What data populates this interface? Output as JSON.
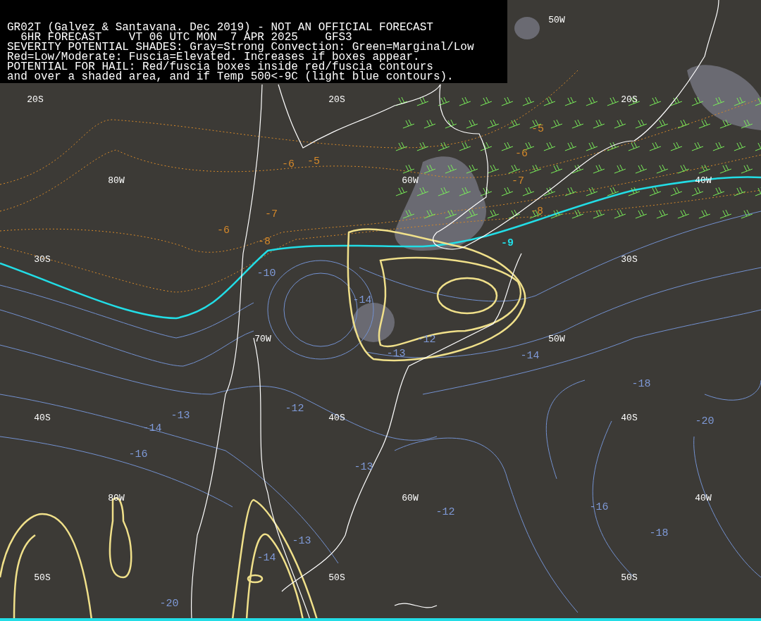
{
  "header": {
    "lines": [
      "GR02T (Galvez & Santavana. Dec 2019) - NOT AN OFFICIAL FORECAST",
      "  6HR FORECAST    VT 06 UTC MON  7 APR 2025    GFS3",
      "SEVERITY POTENTIAL SHADES: Gray=Strong Convection: Green=Marginal/Low",
      "Red=Low/Moderate: Fuscia=Elevated. Increases if boxes appear.",
      "POTENTIAL FOR HAIL: Red/fuscia boxes inside red/fuscia contours",
      "and over a shaded area, and if Temp 500<-9C (light blue contours)."
    ]
  },
  "grid_labels": [
    "50W",
    "20S",
    "20S",
    "20S",
    "80W",
    "60W",
    "40W",
    "30S",
    "30S",
    "70W",
    "50W",
    "40S",
    "40S",
    "40S",
    "80W",
    "60W",
    "40W",
    "50S",
    "50S",
    "50S"
  ],
  "contour_labels": [
    {
      "text": "-5",
      "kind": "height"
    },
    {
      "text": "-6",
      "kind": "height"
    },
    {
      "text": "-6",
      "kind": "height"
    },
    {
      "text": "-5",
      "kind": "height"
    },
    {
      "text": "-7",
      "kind": "height"
    },
    {
      "text": "-6",
      "kind": "height"
    },
    {
      "text": "-7",
      "kind": "height"
    },
    {
      "text": "-8",
      "kind": "height"
    },
    {
      "text": "-8",
      "kind": "height"
    },
    {
      "text": "-9",
      "kind": "threshold"
    },
    {
      "text": "-10",
      "kind": "temperature"
    },
    {
      "text": "-14",
      "kind": "temperature"
    },
    {
      "text": "-12",
      "kind": "temperature"
    },
    {
      "text": "-13",
      "kind": "temperature"
    },
    {
      "text": "-14",
      "kind": "temperature"
    },
    {
      "text": "-18",
      "kind": "temperature"
    },
    {
      "text": "-12",
      "kind": "temperature"
    },
    {
      "text": "-13",
      "kind": "temperature"
    },
    {
      "text": "-20",
      "kind": "temperature"
    },
    {
      "text": "-14",
      "kind": "temperature"
    },
    {
      "text": "-16",
      "kind": "temperature"
    },
    {
      "text": "-13",
      "kind": "temperature"
    },
    {
      "text": "-16",
      "kind": "temperature"
    },
    {
      "text": "-12",
      "kind": "temperature"
    },
    {
      "text": "-13",
      "kind": "temperature"
    },
    {
      "text": "-14",
      "kind": "temperature"
    },
    {
      "text": "-18",
      "kind": "temperature"
    },
    {
      "text": "-20",
      "kind": "temperature"
    }
  ]
}
